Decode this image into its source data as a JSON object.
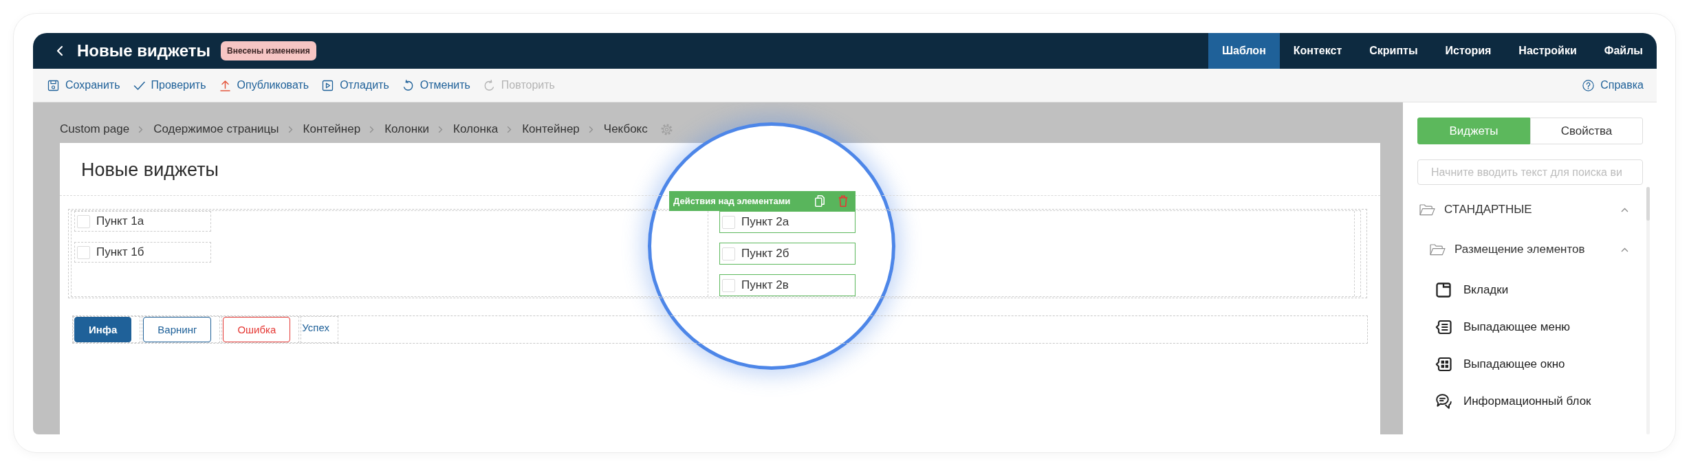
{
  "window": {
    "title": "Новые виджеты",
    "status_badge": "Внесены изменения"
  },
  "header_tabs": [
    {
      "label": "Шаблон",
      "selected": true
    },
    {
      "label": "Контекст",
      "selected": false
    },
    {
      "label": "Скрипты",
      "selected": false
    },
    {
      "label": "История",
      "selected": false
    },
    {
      "label": "Настройки",
      "selected": false
    },
    {
      "label": "Файлы",
      "selected": false
    }
  ],
  "toolbar": {
    "actions": [
      {
        "label": "Сохранить",
        "disabled": false
      },
      {
        "label": "Проверить",
        "disabled": false
      },
      {
        "label": "Опубликовать",
        "disabled": false
      },
      {
        "label": "Отладить",
        "disabled": false
      },
      {
        "label": "Отменить",
        "disabled": false
      },
      {
        "label": "Повторить",
        "disabled": true
      }
    ],
    "help": "Справка"
  },
  "canvas": {
    "breadcrumbs": [
      "Custom page",
      "Содержимое страницы",
      "Контейнер",
      "Колонки",
      "Колонка",
      "Контейнер",
      "Чекбокс"
    ],
    "page": {
      "title": "Новые виджеты",
      "selection_toolbar": {
        "label": "Действия над элементами"
      },
      "columns": [
        {
          "selected": false,
          "items": [
            {
              "label": "Пункт 1а",
              "checked": false
            },
            {
              "label": "Пункт 1б",
              "checked": false
            }
          ]
        },
        {
          "selected": true,
          "items": [
            {
              "label": "Пункт 2а",
              "checked": false
            },
            {
              "label": "Пункт 2б",
              "checked": false
            },
            {
              "label": "Пункт 2в",
              "checked": false
            }
          ]
        }
      ],
      "buttons": [
        {
          "label": "Инфа",
          "kind": "info"
        },
        {
          "label": "Варнинг",
          "kind": "warning"
        },
        {
          "label": "Ошибка",
          "kind": "error"
        },
        {
          "label": "Успех",
          "kind": "success"
        }
      ]
    }
  },
  "sidebar": {
    "tabs": [
      {
        "label": "Виджеты",
        "selected": true
      },
      {
        "label": "Свойства",
        "selected": false
      }
    ],
    "search": {
      "placeholder": "Начните вводить текст для поиска ви"
    },
    "tree": [
      {
        "label": "СТАНДАРТНЫЕ",
        "expanded": true,
        "children": [
          {
            "label": "Размещение элементов",
            "expanded": true,
            "children": [
              {
                "label": "Вкладки"
              },
              {
                "label": "Выпадающее меню"
              },
              {
                "label": "Выпадающее окно"
              },
              {
                "label": "Информационный блок"
              }
            ]
          }
        ]
      }
    ]
  }
}
